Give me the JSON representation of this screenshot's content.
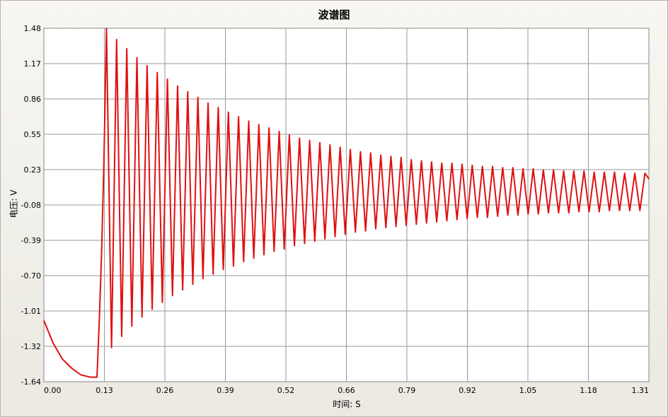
{
  "chart_data": {
    "type": "line",
    "title": "波谱图",
    "xlabel": "时间: S",
    "ylabel": "电压: V",
    "xlim": [
      0.0,
      1.31
    ],
    "ylim": [
      -1.64,
      1.48
    ],
    "xticks": [
      "0.00",
      "0.13",
      "0.26",
      "0.39",
      "0.52",
      "0.66",
      "0.79",
      "0.92",
      "1.05",
      "1.18",
      "1.31"
    ],
    "yticks": [
      "1.48",
      "1.17",
      "0.86",
      "0.55",
      "0.23",
      "-0.08",
      "-0.39",
      "-0.70",
      "-1.01",
      "-1.32",
      "-1.64"
    ],
    "grid": true,
    "series": [
      {
        "color": "#e01010",
        "x": [
          0.0,
          0.02,
          0.04,
          0.06,
          0.08,
          0.1,
          0.115,
          0.12,
          0.125,
          0.13,
          0.1355,
          0.1465,
          0.1575,
          0.1685,
          0.1795,
          0.1905,
          0.2015,
          0.2125,
          0.2235,
          0.2345,
          0.2455,
          0.2565,
          0.2675,
          0.2785,
          0.2895,
          0.3005,
          0.3115,
          0.3225,
          0.3335,
          0.3445,
          0.3555,
          0.3665,
          0.3775,
          0.3885,
          0.3995,
          0.4105,
          0.4215,
          0.4325,
          0.4435,
          0.4545,
          0.4655,
          0.4765,
          0.4875,
          0.4985,
          0.5095,
          0.5205,
          0.5315,
          0.5425,
          0.5535,
          0.5645,
          0.5755,
          0.5865,
          0.5975,
          0.6085,
          0.6195,
          0.6305,
          0.6415,
          0.6525,
          0.6635,
          0.6745,
          0.6855,
          0.6965,
          0.7075,
          0.7185,
          0.7295,
          0.7405,
          0.7515,
          0.7625,
          0.7735,
          0.7845,
          0.7955,
          0.8065,
          0.8175,
          0.8285,
          0.8395,
          0.8505,
          0.8615,
          0.8725,
          0.8835,
          0.8945,
          0.9055,
          0.9165,
          0.9275,
          0.9385,
          0.9495,
          0.9605,
          0.9715,
          0.9825,
          0.9935,
          1.0045,
          1.0155,
          1.0265,
          1.0375,
          1.0485,
          1.0595,
          1.0705,
          1.0815,
          1.0925,
          1.1035,
          1.1145,
          1.1255,
          1.1365,
          1.1475,
          1.1585,
          1.1695,
          1.1805,
          1.1915,
          1.2025,
          1.2135,
          1.2245,
          1.2355,
          1.2465,
          1.2575,
          1.2685,
          1.2795,
          1.2905,
          1.3015,
          1.31
        ],
        "y": [
          -1.1,
          -1.3,
          -1.44,
          -1.52,
          -1.58,
          -1.6,
          -1.6,
          -1.1,
          -0.5,
          0.3,
          1.48,
          -1.34,
          1.38,
          -1.24,
          1.3,
          -1.15,
          1.22,
          -1.07,
          1.15,
          -1.0,
          1.09,
          -0.94,
          1.03,
          -0.88,
          0.97,
          -0.83,
          0.92,
          -0.78,
          0.87,
          -0.73,
          0.82,
          -0.69,
          0.78,
          -0.65,
          0.74,
          -0.62,
          0.7,
          -0.58,
          0.66,
          -0.55,
          0.63,
          -0.52,
          0.6,
          -0.49,
          0.57,
          -0.47,
          0.54,
          -0.44,
          0.51,
          -0.42,
          0.49,
          -0.4,
          0.47,
          -0.38,
          0.45,
          -0.36,
          0.43,
          -0.34,
          0.41,
          -0.32,
          0.39,
          -0.31,
          0.38,
          -0.29,
          0.36,
          -0.28,
          0.35,
          -0.27,
          0.34,
          -0.26,
          0.32,
          -0.25,
          0.31,
          -0.24,
          0.3,
          -0.23,
          0.29,
          -0.22,
          0.29,
          -0.21,
          0.28,
          -0.2,
          0.27,
          -0.19,
          0.26,
          -0.19,
          0.26,
          -0.18,
          0.25,
          -0.17,
          0.25,
          -0.17,
          0.24,
          -0.16,
          0.24,
          -0.16,
          0.23,
          -0.15,
          0.23,
          -0.15,
          0.22,
          -0.15,
          0.22,
          -0.14,
          0.22,
          -0.14,
          0.21,
          -0.14,
          0.21,
          -0.13,
          0.21,
          -0.13,
          0.2,
          -0.13,
          0.2,
          -0.13,
          0.2,
          0.15
        ]
      }
    ]
  }
}
